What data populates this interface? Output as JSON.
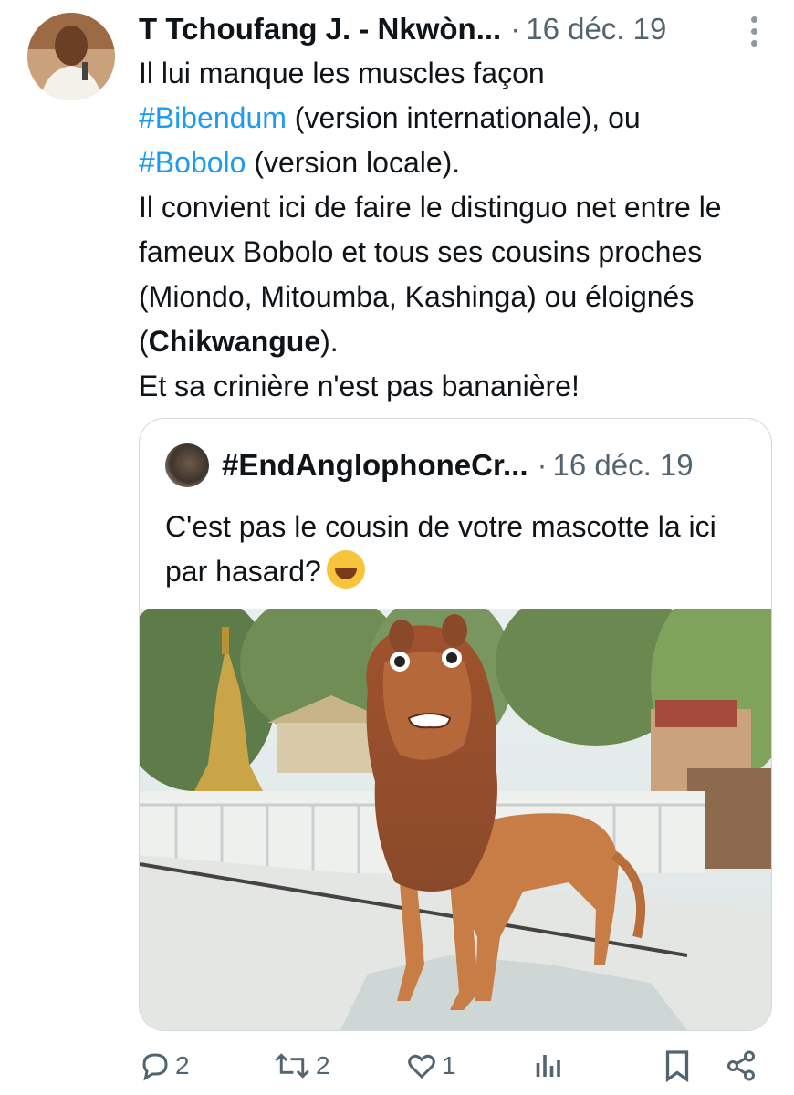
{
  "tweet": {
    "author": "T Tchoufang J. - Nkwòn...",
    "separator": "·",
    "date": "16 déc. 19",
    "text": {
      "line1": "Il lui manque les muscles façon",
      "hashtag1": "#Bibendum",
      "line2_rest": " (version internationale), ou",
      "hashtag2": "#Bobolo",
      "line3_rest": " (version locale).",
      "line4": "Il convient ici de faire le distinguo net entre le fameux Bobolo et tous ses cousins proches (Miondo, Mitoumba, Kashinga) ou éloignés (",
      "bold_word": "Chikwangue",
      "line4_end": ").",
      "line5": "Et sa crinière n'est pas bananière!"
    }
  },
  "quote": {
    "author": "#EndAnglophoneCr...",
    "separator": "·",
    "date": "16 déc. 19",
    "text": "C'est pas le cousin de votre mascotte la ici par hasard?",
    "emoji": "face-with-tears-of-joy"
  },
  "actions": {
    "reply_count": "2",
    "retweet_count": "2",
    "like_count": "1"
  },
  "colors": {
    "hashtag": "#1d9bf0",
    "secondary_text": "#536471",
    "border": "#cfd9de"
  },
  "icons": [
    "more-icon",
    "reply-icon",
    "retweet-icon",
    "like-icon",
    "views-icon",
    "bookmark-icon",
    "share-icon"
  ]
}
